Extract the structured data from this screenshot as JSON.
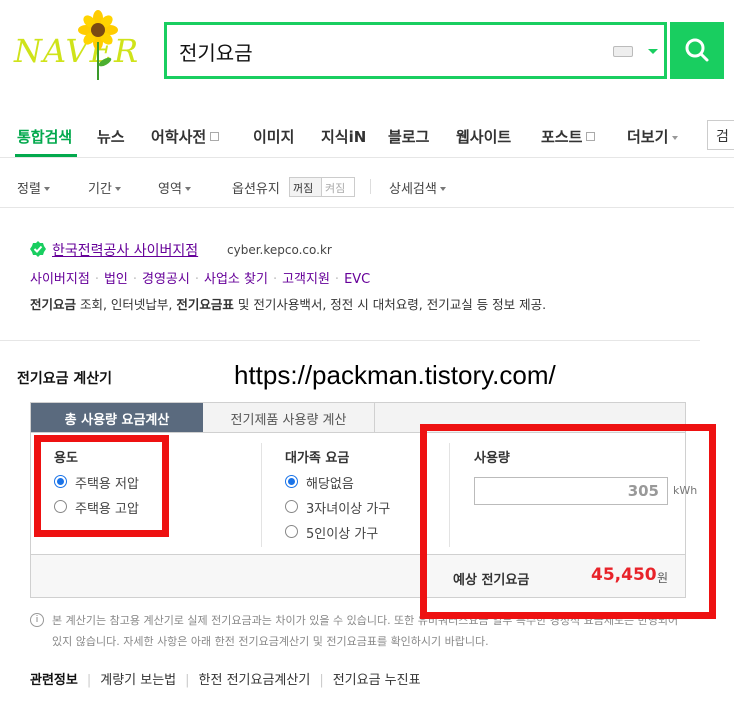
{
  "logo": {
    "text": "NAVER"
  },
  "search": {
    "query": "전기요금"
  },
  "tabs": [
    {
      "label": "통합검색"
    },
    {
      "label": "뉴스"
    },
    {
      "label": "어학사전"
    },
    {
      "label": "이미지"
    },
    {
      "label": "지식iN"
    },
    {
      "label": "블로그"
    },
    {
      "label": "웹사이트"
    },
    {
      "label": "포스트"
    },
    {
      "label": "더보기"
    }
  ],
  "tab_search_frag": "검",
  "options": {
    "sort": "정렬",
    "period": "기간",
    "area": "영역",
    "keep_option": "옵션유지",
    "toggle_on": "꺼짐",
    "toggle_off": "켜짐",
    "detail": "상세검색"
  },
  "result": {
    "site_name": "한국전력공사 사이버지점",
    "site_url": "cyber.kepco.co.kr",
    "sitelinks": [
      "사이버지점",
      "법인",
      "경영공시",
      "사업소 찾기",
      "고객지원",
      "EVC"
    ],
    "desc_parts": [
      "전기요금",
      " 조회, 인터넷납부, ",
      "전기요금표",
      " 및 전기사용백서, 정전 시 대처요령, 전기교실 등 정보 제공."
    ]
  },
  "calculator": {
    "title": "전기요금 계산기",
    "watermark": "https://packman.tistory.com/",
    "tab_active": "총 사용량 요금계산",
    "tab_inactive": "전기제품 사용량 계산",
    "usage_group": {
      "label": "용도",
      "options": [
        {
          "label": "주택용 저압",
          "selected": true
        },
        {
          "label": "주택용 고압",
          "selected": false
        }
      ]
    },
    "family_group": {
      "label": "대가족 요금",
      "options": [
        {
          "label": "해당없음",
          "selected": true
        },
        {
          "label": "3자녀이상 가구",
          "selected": false
        },
        {
          "label": "5인이상 가구",
          "selected": false
        }
      ]
    },
    "consumption": {
      "label": "사용량",
      "value": "305",
      "unit": "kWh"
    },
    "estimate": {
      "label": "예상 전기요금",
      "value": "45,450",
      "unit": "원"
    },
    "accent_color": "#e8232a"
  },
  "note": {
    "icon": "i",
    "text": "본 계산기는 참고용 계산기로 실제 전기요금과는 차이가 있을 수 있습니다. 또한 유비쿼터스요금 일부 특수한 경정적 요금제도는 반영되어 있지 않습니다. 자세한 사항은 아래 한전 전기요금계산기 및 전기요금표를 확인하시기 바랍니다."
  },
  "related": {
    "title": "관련정보",
    "links": [
      "계량기 보는법",
      "한전 전기요금계산기",
      "전기요금 누진표"
    ]
  }
}
